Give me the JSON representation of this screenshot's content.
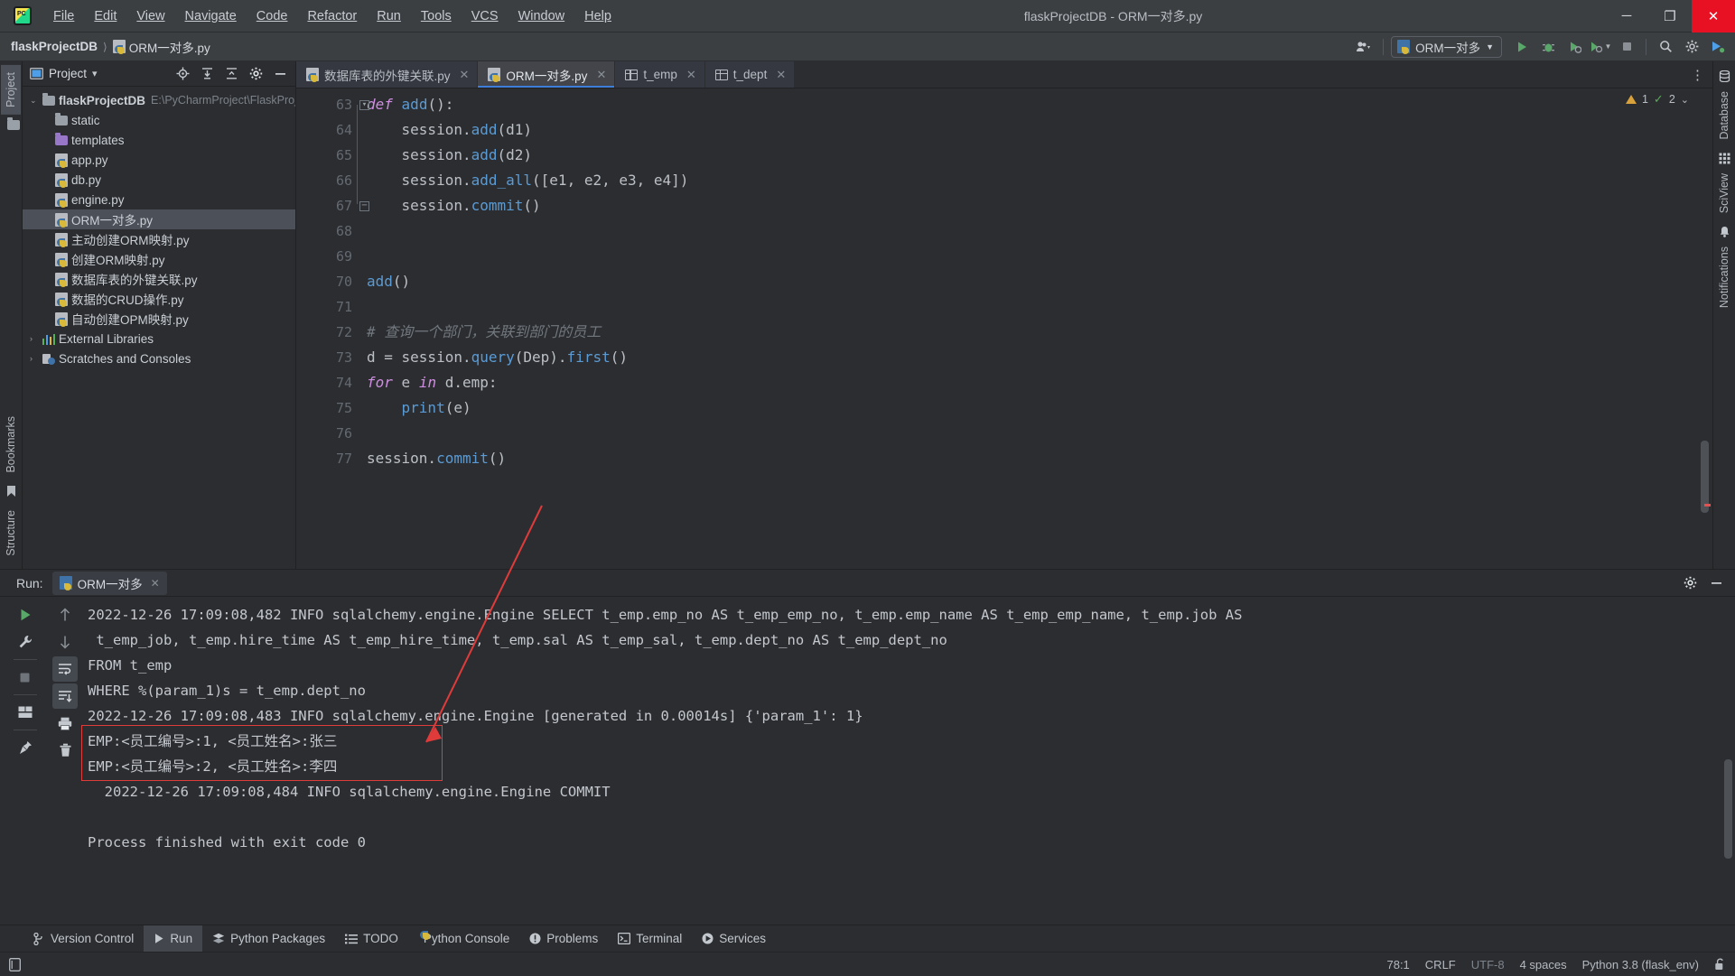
{
  "window": {
    "title": "flaskProjectDB - ORM一对多.py",
    "minimize_label": "─",
    "maximize_label": "❐",
    "close_label": "✕"
  },
  "menu": {
    "items": [
      {
        "label": "File"
      },
      {
        "label": "Edit"
      },
      {
        "label": "View"
      },
      {
        "label": "Navigate"
      },
      {
        "label": "Code"
      },
      {
        "label": "Refactor"
      },
      {
        "label": "Run"
      },
      {
        "label": "Tools"
      },
      {
        "label": "VCS"
      },
      {
        "label": "Window"
      },
      {
        "label": "Help"
      }
    ]
  },
  "breadcrumb": {
    "project": "flaskProjectDB",
    "separator": "⟩",
    "file": "ORM一对多.py"
  },
  "toolbar": {
    "run_config": "ORM一对多",
    "run_icon": "run-icon",
    "debug_icon": "debug-icon",
    "coverage_icon": "coverage-icon",
    "profile_icon": "profile-icon",
    "stop_icon": "stop-icon",
    "search_icon": "search-icon",
    "settings_icon": "settings-icon",
    "updates_icon": "updates-icon",
    "account_icon": "account-icon"
  },
  "left_strip": {
    "tabs": [
      {
        "label": "Project",
        "active": true
      },
      {
        "label": "Bookmarks",
        "active": false
      },
      {
        "label": "Structure",
        "active": false
      }
    ]
  },
  "right_strip": {
    "tabs": [
      {
        "label": "Database"
      },
      {
        "label": "SciView"
      },
      {
        "label": "Notifications"
      }
    ]
  },
  "project_panel": {
    "title": "Project",
    "chevron": "▾",
    "actions": [
      "locate-icon",
      "expand-all-icon",
      "collapse-all-icon",
      "settings-icon",
      "hide-icon"
    ],
    "tree": [
      {
        "arrow": "⌄",
        "icon": "folder",
        "label": "flaskProjectDB",
        "bold": true,
        "path": "E:\\PyCharmProject\\FlaskProj",
        "indent": 0,
        "selected": false
      },
      {
        "arrow": "",
        "icon": "folder",
        "label": "static",
        "bold": false,
        "path": "",
        "indent": 1,
        "selected": false
      },
      {
        "arrow": "",
        "icon": "folder-violet",
        "label": "templates",
        "bold": false,
        "path": "",
        "indent": 1,
        "selected": false
      },
      {
        "arrow": "",
        "icon": "python",
        "label": "app.py",
        "bold": false,
        "path": "",
        "indent": 1,
        "selected": false
      },
      {
        "arrow": "",
        "icon": "python",
        "label": "db.py",
        "bold": false,
        "path": "",
        "indent": 1,
        "selected": false
      },
      {
        "arrow": "",
        "icon": "python",
        "label": "engine.py",
        "bold": false,
        "path": "",
        "indent": 1,
        "selected": false
      },
      {
        "arrow": "",
        "icon": "python",
        "label": "ORM一对多.py",
        "bold": false,
        "path": "",
        "indent": 1,
        "selected": true
      },
      {
        "arrow": "",
        "icon": "python",
        "label": "主动创建ORM映射.py",
        "bold": false,
        "path": "",
        "indent": 1,
        "selected": false
      },
      {
        "arrow": "",
        "icon": "python",
        "label": "创建ORM映射.py",
        "bold": false,
        "path": "",
        "indent": 1,
        "selected": false
      },
      {
        "arrow": "",
        "icon": "python",
        "label": "数据库表的外键关联.py",
        "bold": false,
        "path": "",
        "indent": 1,
        "selected": false
      },
      {
        "arrow": "",
        "icon": "python",
        "label": "数据的CRUD操作.py",
        "bold": false,
        "path": "",
        "indent": 1,
        "selected": false
      },
      {
        "arrow": "",
        "icon": "python",
        "label": "自动创建OPM映射.py",
        "bold": false,
        "path": "",
        "indent": 1,
        "selected": false
      },
      {
        "arrow": "›",
        "icon": "library",
        "label": "External Libraries",
        "bold": false,
        "path": "",
        "indent": 0,
        "selected": false
      },
      {
        "arrow": "›",
        "icon": "scratch",
        "label": "Scratches and Consoles",
        "bold": false,
        "path": "",
        "indent": 0,
        "selected": false
      }
    ]
  },
  "editor": {
    "tabs": [
      {
        "label": "数据库表的外键关联.py",
        "icon": "python",
        "active": false,
        "close": "✕"
      },
      {
        "label": "ORM一对多.py",
        "icon": "python",
        "active": true,
        "close": "✕"
      },
      {
        "label": "t_emp",
        "icon": "table",
        "active": false,
        "close": "✕"
      },
      {
        "label": "t_dept",
        "icon": "table",
        "active": false,
        "close": "✕"
      }
    ],
    "more_icon": "more-vertical-icon",
    "inspection": {
      "warning_count": "1",
      "ok_count": "2",
      "chevron": "⌄"
    },
    "first_line_number": 63,
    "lines": [
      {
        "no": "63",
        "text": "def add():"
      },
      {
        "no": "64",
        "text": "    session.add(d1)"
      },
      {
        "no": "65",
        "text": "    session.add(d2)"
      },
      {
        "no": "66",
        "text": "    session.add_all([e1, e2, e3, e4])"
      },
      {
        "no": "67",
        "text": "    session.commit()"
      },
      {
        "no": "68",
        "text": ""
      },
      {
        "no": "69",
        "text": ""
      },
      {
        "no": "70",
        "text": "add()"
      },
      {
        "no": "71",
        "text": ""
      },
      {
        "no": "72",
        "text": "# 查询一个部门，关联到部门的员工"
      },
      {
        "no": "73",
        "text": "d = session.query(Dep).first()"
      },
      {
        "no": "74",
        "text": "for e in d.emp:"
      },
      {
        "no": "75",
        "text": "    print(e)"
      },
      {
        "no": "76",
        "text": ""
      },
      {
        "no": "77",
        "text": "session.commit()"
      }
    ]
  },
  "run_panel": {
    "label": "Run:",
    "tab_label": "ORM一对多",
    "tab_close": "✕",
    "settings_icon": "settings-icon",
    "hide_icon": "hide-icon",
    "tools": [
      {
        "name": "rerun-icon"
      },
      {
        "name": "wrench-icon"
      },
      {
        "name": "stop-icon"
      },
      {
        "name": "layout-icon"
      },
      {
        "name": "pin-icon"
      }
    ],
    "tools2": [
      {
        "name": "arrow-up-icon"
      },
      {
        "name": "arrow-down-icon"
      },
      {
        "name": "soft-wrap-icon"
      },
      {
        "name": "scroll-end-icon"
      },
      {
        "name": "print-icon"
      },
      {
        "name": "trash-icon"
      }
    ],
    "output": [
      "2022-12-26 17:09:08,482 INFO sqlalchemy.engine.Engine SELECT t_emp.emp_no AS t_emp_emp_no, t_emp.emp_name AS t_emp_emp_name, t_emp.job AS",
      " t_emp_job, t_emp.hire_time AS t_emp_hire_time, t_emp.sal AS t_emp_sal, t_emp.dept_no AS t_emp_dept_no",
      "FROM t_emp",
      "WHERE %(param_1)s = t_emp.dept_no",
      "2022-12-26 17:09:08,483 INFO sqlalchemy.engine.Engine [generated in 0.00014s] {'param_1': 1}",
      "EMP:<员工编号>:1, <员工姓名>:张三",
      "EMP:<员工编号>:2, <员工姓名>:李四",
      "  2022-12-26 17:09:08,484 INFO sqlalchemy.engine.Engine COMMIT",
      "",
      "Process finished with exit code 0"
    ],
    "highlight_color": "#e03b3b",
    "highlighted_lines": [
      5,
      6
    ]
  },
  "bottom_tabs": [
    {
      "label": "Version Control",
      "icon": "branch-icon",
      "active": false
    },
    {
      "label": "Run",
      "icon": "play-icon",
      "active": true
    },
    {
      "label": "Python Packages",
      "icon": "packages-icon",
      "active": false
    },
    {
      "label": "TODO",
      "icon": "todo-icon",
      "active": false
    },
    {
      "label": "Python Console",
      "icon": "python-icon",
      "active": false
    },
    {
      "label": "Problems",
      "icon": "problems-icon",
      "active": false
    },
    {
      "label": "Terminal",
      "icon": "terminal-icon",
      "active": false
    },
    {
      "label": "Services",
      "icon": "services-icon",
      "active": false
    }
  ],
  "statusbar": {
    "left_icon": "ide-widget-icon",
    "caret": "78:1",
    "line_sep": "CRLF",
    "encoding": "UTF-8",
    "indent": "4 spaces",
    "interpreter": "Python 3.8 (flask_env)",
    "lock_icon": "unlocked-icon"
  }
}
